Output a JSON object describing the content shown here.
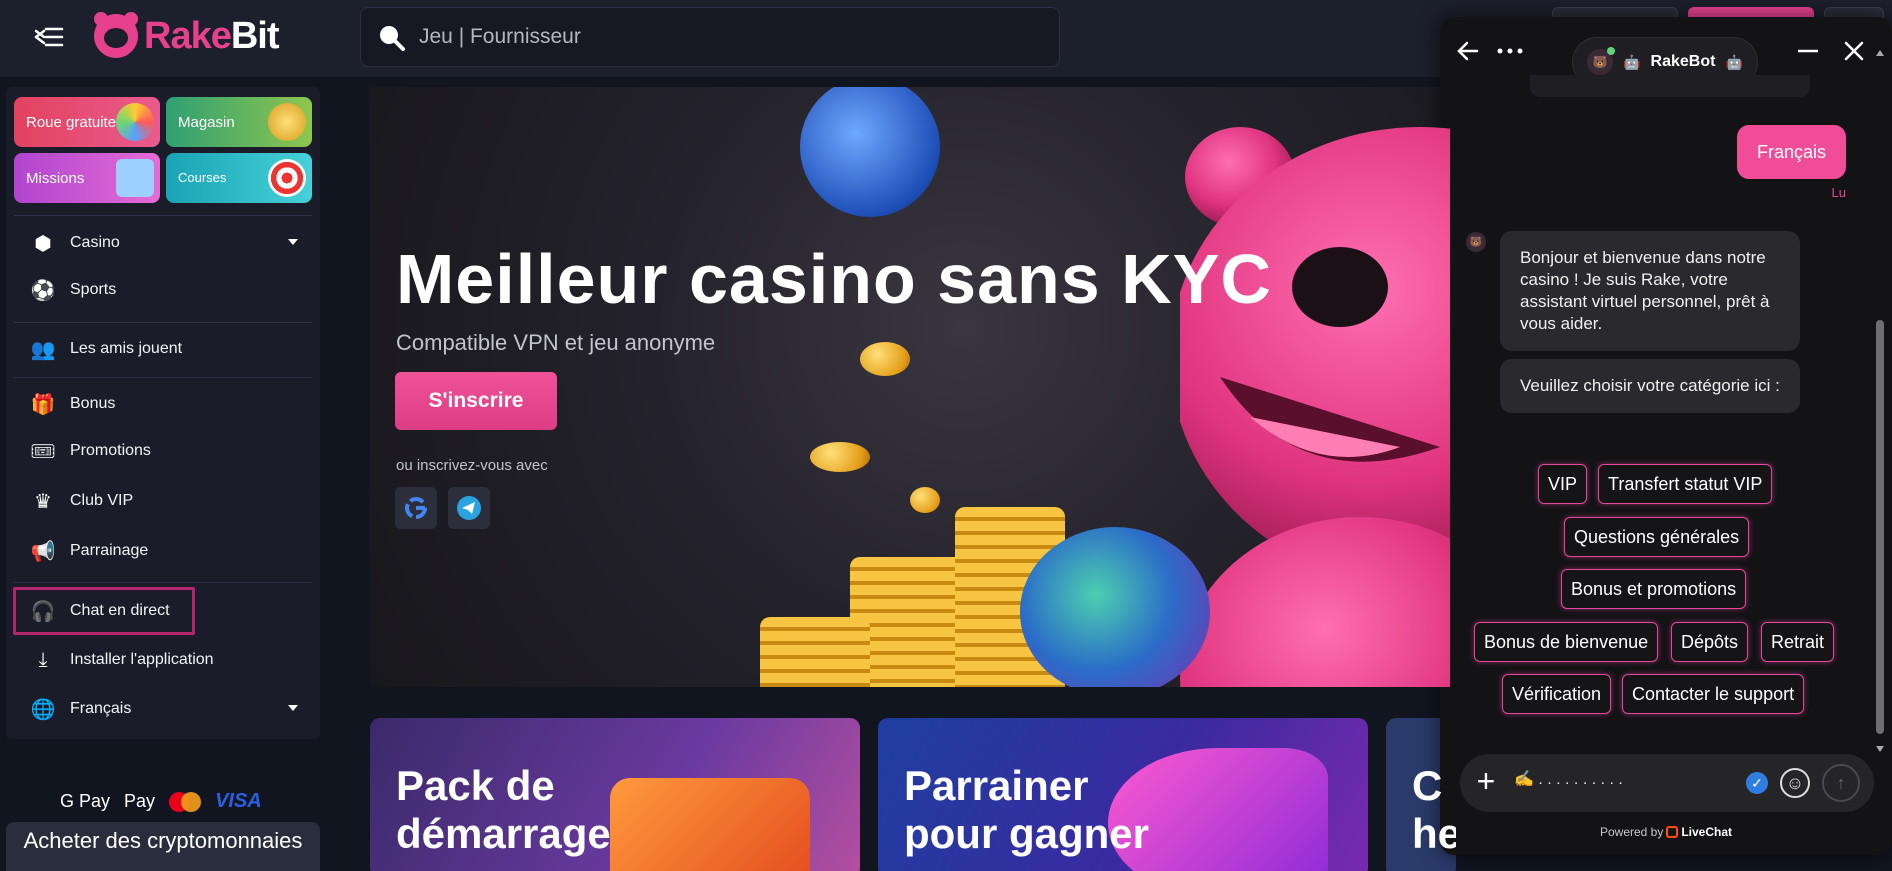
{
  "header": {
    "brand_prefix": "Rake",
    "brand_suffix": "Bit",
    "search_placeholder": "Jeu | Fournisseur"
  },
  "sidebar": {
    "tiles": [
      {
        "label": "Roue gratuite"
      },
      {
        "label": "Magasin"
      },
      {
        "label": "Missions"
      },
      {
        "label": "Courses"
      }
    ],
    "items": [
      {
        "label": "Casino",
        "icon": "dice-icon"
      },
      {
        "label": "Sports",
        "icon": "ball-icon"
      },
      {
        "label": "Les amis jouent",
        "icon": "friends-icon"
      },
      {
        "label": "Bonus",
        "icon": "gift-icon"
      },
      {
        "label": "Promotions",
        "icon": "ticket-icon"
      },
      {
        "label": "Club VIP",
        "icon": "crown-icon"
      },
      {
        "label": "Parrainage",
        "icon": "megaphone-icon"
      },
      {
        "label": "Chat en direct",
        "icon": "headset-icon"
      },
      {
        "label": "Installer l'application",
        "icon": "download-icon"
      },
      {
        "label": "Français",
        "icon": "globe-icon"
      }
    ],
    "payments": {
      "gpay": "G Pay",
      "applepay": "Pay",
      "visa": "VISA"
    },
    "buy_label": "Acheter des cryptomonnaies"
  },
  "hero": {
    "title": "Meilleur casino sans KYC",
    "subtitle": "Compatible VPN et jeu anonyme",
    "signup_label": "S'inscrire",
    "or_text": "ou inscrivez-vous avec"
  },
  "promo_cards": [
    {
      "title_line1": "Pack de",
      "title_line2": "démarrage"
    },
    {
      "title_line1": "Parrainer",
      "title_line2": "pour gagner"
    },
    {
      "title_line1": "C",
      "title_line2": "hebdomadaires"
    }
  ],
  "chat": {
    "bot_name": "RakeBot",
    "user_message": "Français",
    "read_status": "Lu",
    "bot_messages": [
      "Bonjour et bienvenue dans notre casino ! Je suis Rake, votre assistant virtuel personnel, prêt à vous aider.",
      "Veuillez choisir votre catégorie ici :"
    ],
    "options": [
      "VIP",
      "Transfert statut VIP",
      "Questions générales",
      "Bonus et promotions",
      "Bonus de bienvenue",
      "Dépôts",
      "Retrait",
      "Vérification",
      "Contacter le support"
    ],
    "composer_value": "✍️ . . . . . . . . . .",
    "powered_by": "Powered by",
    "powered_brand": "LiveChat"
  },
  "colors": {
    "accent": "#e7418d",
    "background": "#111520",
    "sidebar": "#1a1d29",
    "chat_bg": "#131316"
  }
}
